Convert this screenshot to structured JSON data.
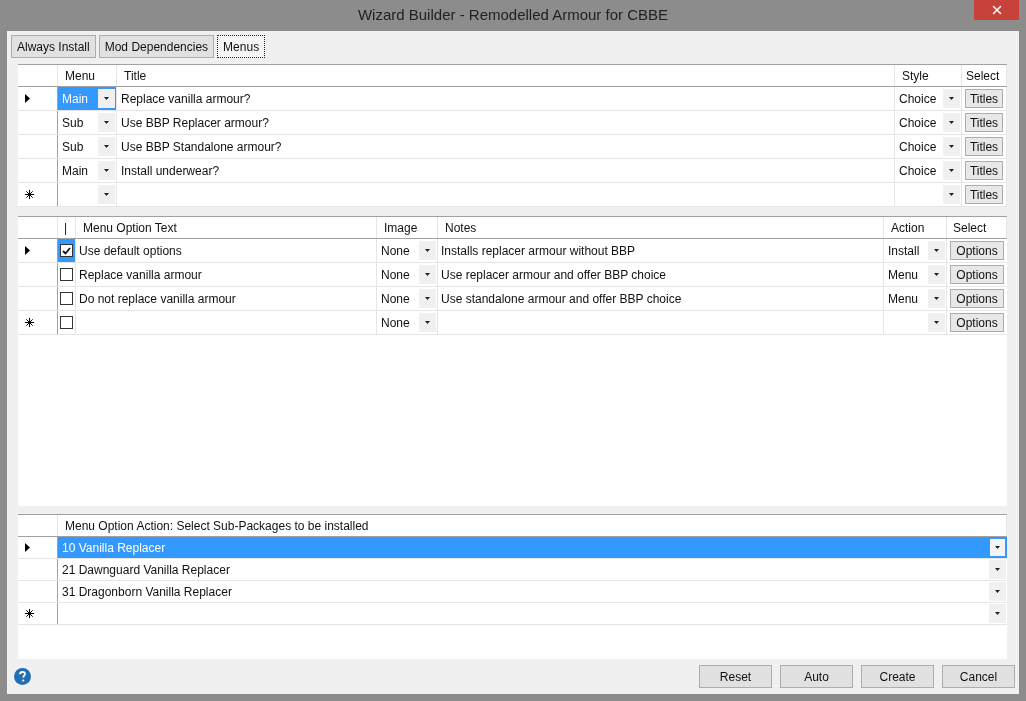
{
  "window": {
    "title": "Wizard Builder - Remodelled Armour for CBBE"
  },
  "tabs": [
    {
      "label": "Always Install",
      "selected": false
    },
    {
      "label": "Mod Dependencies",
      "selected": false
    },
    {
      "label": "Menus",
      "selected": true
    }
  ],
  "menus_grid": {
    "columns": [
      "Menu",
      "Title",
      "Style",
      "Select"
    ],
    "rows": [
      {
        "kind": "entry",
        "selected": true,
        "menu": "Main",
        "title": "Replace vanilla armour?",
        "style": "Choice",
        "select": "Titles"
      },
      {
        "kind": "entry",
        "selected": false,
        "menu": "Sub",
        "title": "Use BBP Replacer armour?",
        "style": "Choice",
        "select": "Titles"
      },
      {
        "kind": "entry",
        "selected": false,
        "menu": "Sub",
        "title": "Use BBP Standalone armour?",
        "style": "Choice",
        "select": "Titles"
      },
      {
        "kind": "entry",
        "selected": false,
        "menu": "Main",
        "title": "Install underwear?",
        "style": "Choice",
        "select": "Titles"
      },
      {
        "kind": "new",
        "selected": false,
        "select": "Titles"
      }
    ]
  },
  "options_grid": {
    "columns": [
      "|",
      "Menu Option Text",
      "Image",
      "Notes",
      "Action",
      "Select"
    ],
    "rows": [
      {
        "kind": "entry",
        "selected": true,
        "checked": true,
        "text": "Use default options",
        "image": "None",
        "notes": "Installs replacer armour without BBP",
        "action": "Install",
        "select": "Options"
      },
      {
        "kind": "entry",
        "selected": false,
        "checked": false,
        "text": "Replace vanilla armour",
        "image": "None",
        "notes": "Use replacer armour and offer BBP choice",
        "action": "Menu",
        "select": "Options"
      },
      {
        "kind": "entry",
        "selected": false,
        "checked": false,
        "text": "Do not replace vanilla armour",
        "image": "None",
        "notes": "Use standalone armour and offer BBP choice",
        "action": "Menu",
        "select": "Options"
      },
      {
        "kind": "new",
        "selected": false,
        "checked": false,
        "image": "None",
        "select": "Options"
      }
    ]
  },
  "packages_grid": {
    "columns": [
      "Menu Option Action: Select Sub-Packages to be installed"
    ],
    "rows": [
      {
        "kind": "entry",
        "selected": true,
        "package": "10 Vanilla Replacer"
      },
      {
        "kind": "entry",
        "selected": false,
        "package": "21 Dawnguard Vanilla Replacer"
      },
      {
        "kind": "entry",
        "selected": false,
        "package": "31 Dragonborn Vanilla Replacer"
      },
      {
        "kind": "new",
        "selected": false
      }
    ]
  },
  "buttons": [
    "Reset",
    "Auto",
    "Create",
    "Cancel"
  ]
}
